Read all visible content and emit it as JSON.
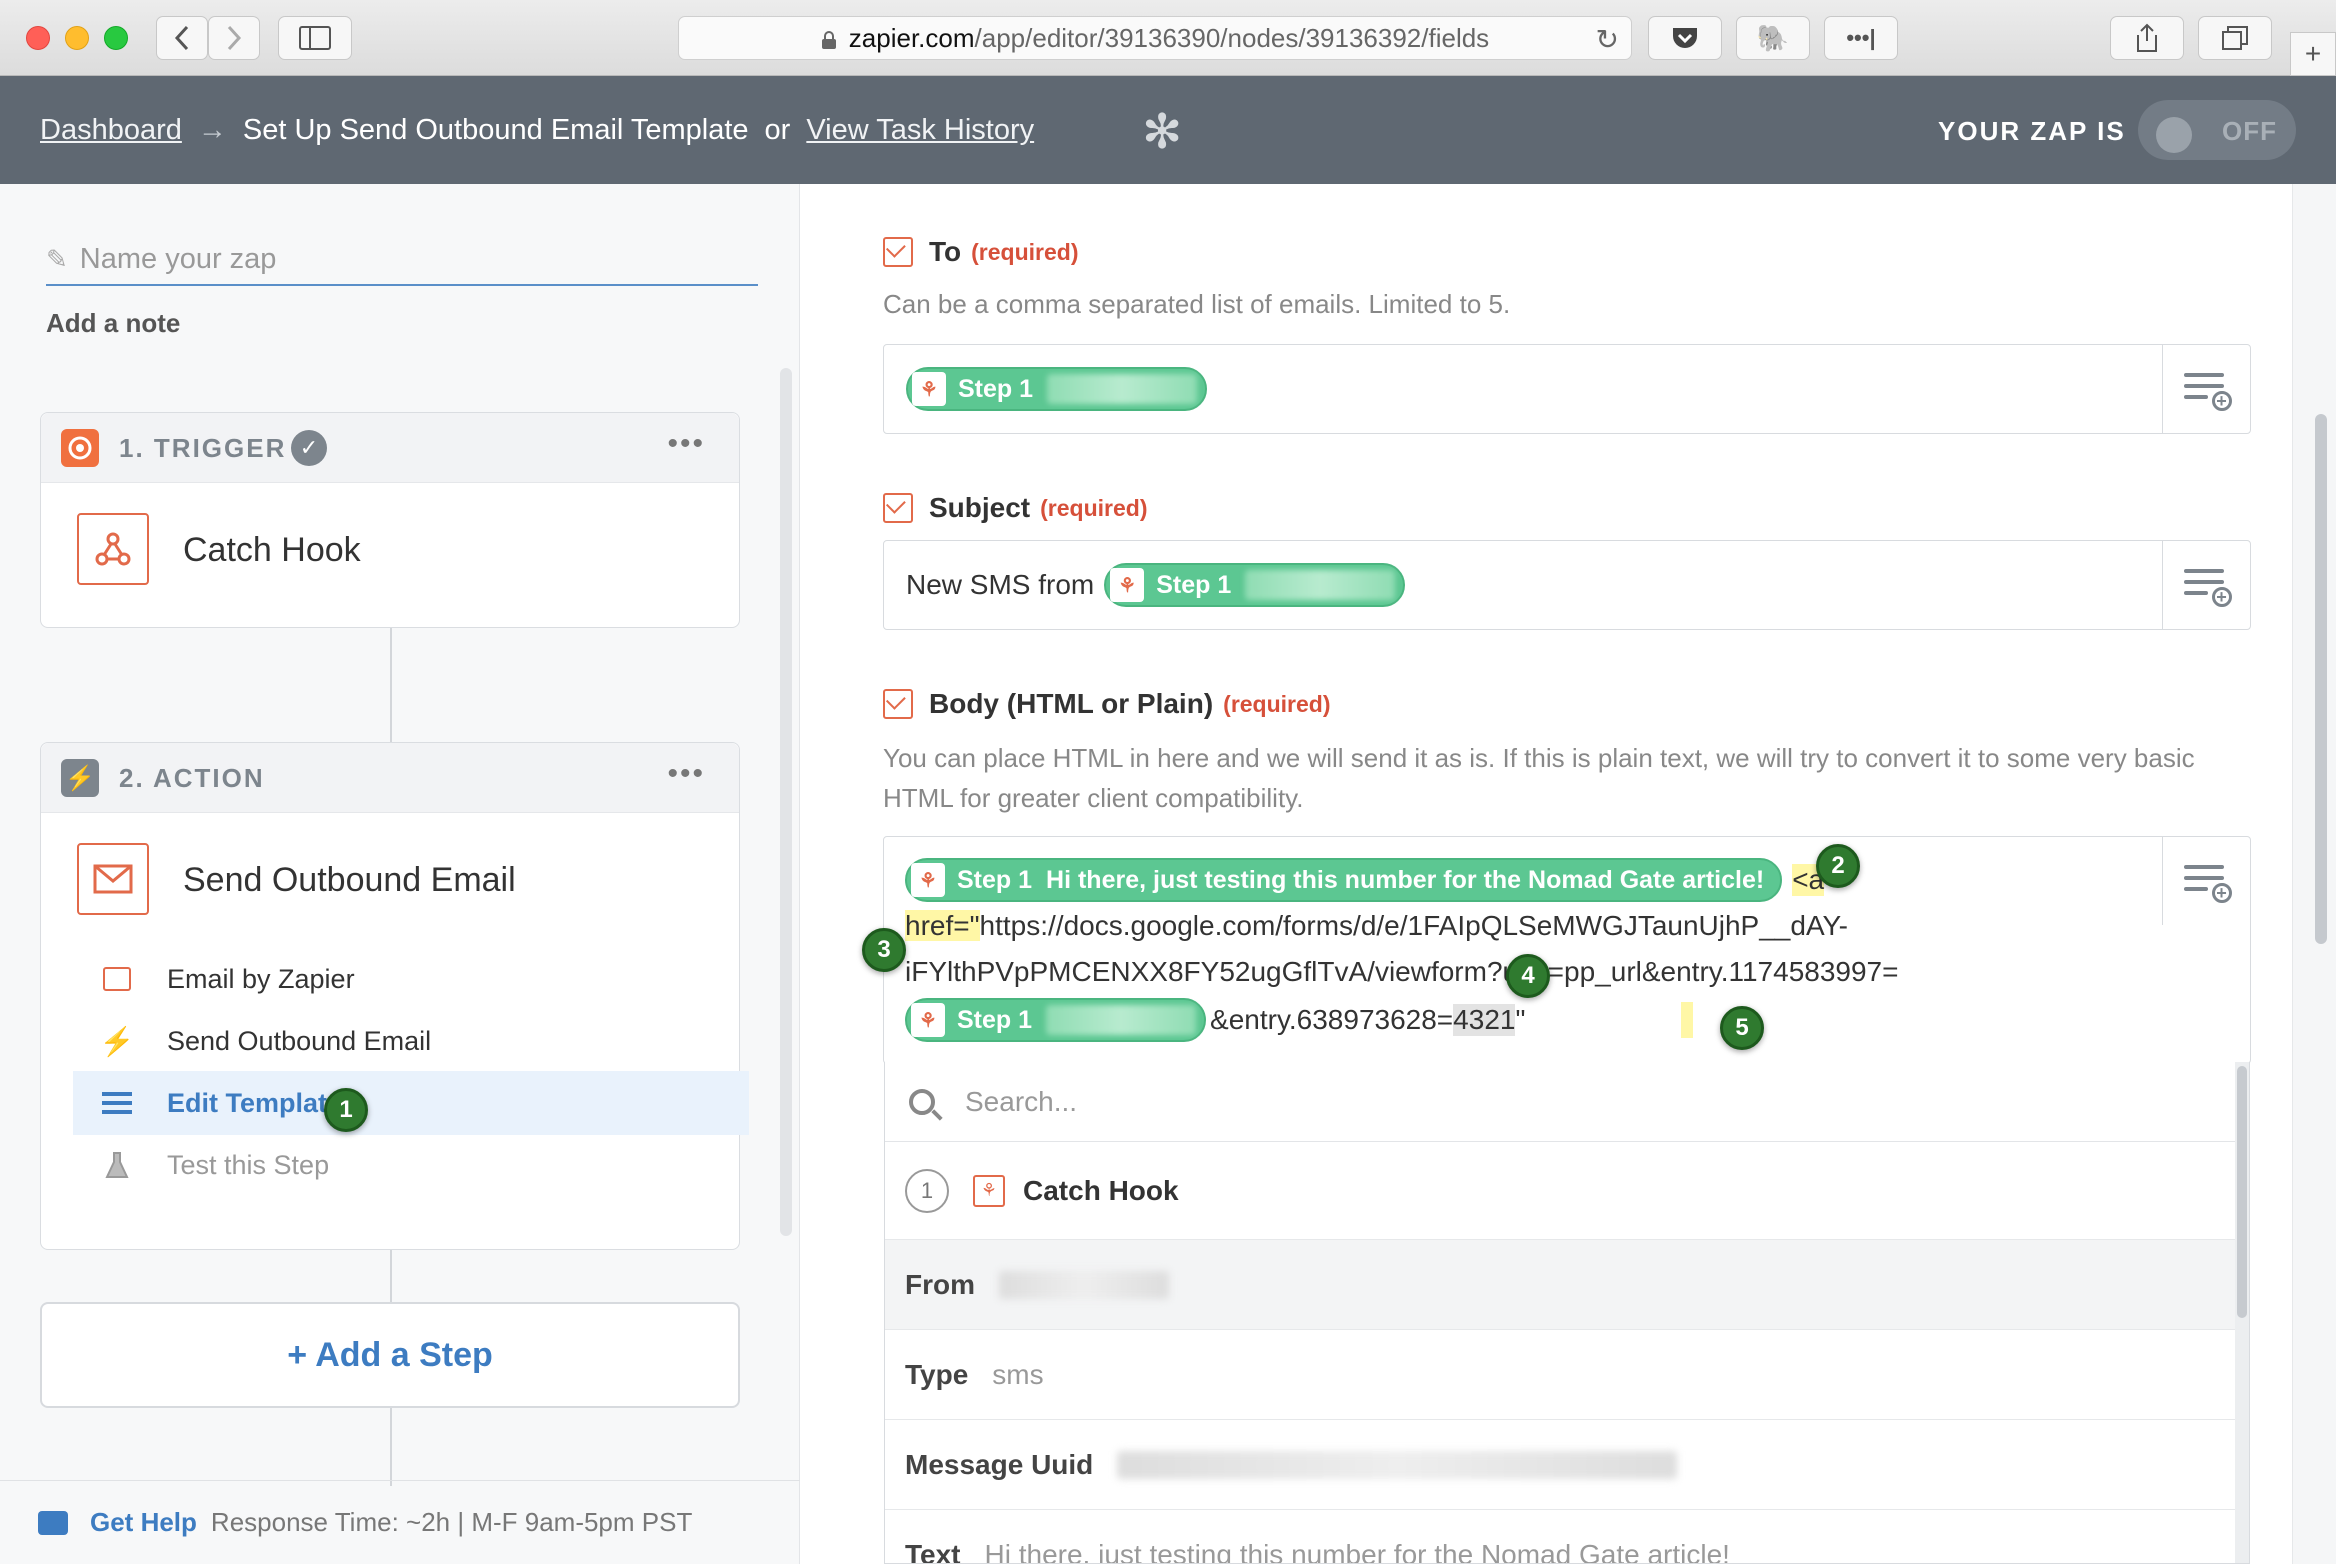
{
  "browser": {
    "url_host": "zapier.com",
    "url_path": "/app/editor/39136390/nodes/39136392/fields",
    "more_label": "•••|"
  },
  "header": {
    "dashboard": "Dashboard",
    "arrow": "→",
    "title": "Set Up Send Outbound Email Template",
    "or": "or",
    "task_history": "View Task History",
    "your_zap_is": "YOUR ZAP IS",
    "toggle_state": "OFF"
  },
  "sidebar": {
    "name_placeholder": "Name your zap",
    "add_note": "Add a note",
    "trigger": {
      "title": "1. TRIGGER",
      "app": "Catch Hook"
    },
    "action": {
      "title": "2. ACTION",
      "app": "Send Outbound Email",
      "items": [
        {
          "label": "Email by Zapier"
        },
        {
          "label": "Send Outbound Email"
        },
        {
          "label": "Edit Template"
        },
        {
          "label": "Test this Step"
        }
      ]
    },
    "add_step": "+ Add a Step",
    "help": {
      "link": "Get Help",
      "text": "Response Time: ~2h | M-F 9am-5pm PST"
    }
  },
  "fields": {
    "to": {
      "label": "To",
      "required": "(required)",
      "help": "Can be a comma separated list of emails. Limited to 5.",
      "pill": "Step 1"
    },
    "subject": {
      "label": "Subject",
      "required": "(required)",
      "prefix": "New SMS from",
      "pill": "Step 1"
    },
    "body": {
      "label": "Body (HTML or Plain)",
      "required": "(required)",
      "help_line1": "You can place HTML in here and we will send it as is. If this is plain text, we will try to convert it to some very basic",
      "help_line2": "HTML for greater client compatibility.",
      "pill1_step": "Step 1",
      "pill1_text": "Hi there, just testing this number for the Nomad Gate article!",
      "tag_open": "<a",
      "line2_href": "href=\"",
      "line2_rest": "https://docs.google.com/forms/d/e/1FAIpQLSeMWGJTaunUjhP__dAY-",
      "line3": "iFYlthPVpPMCENXX8FY52ugGflTvA/viewform?usp=pp_url&entry.1174583997=",
      "pill2_step": "Step 1",
      "line4_a": "&entry.638973628=",
      "line4_b": "4321",
      "line4_c": "\""
    }
  },
  "dropdown": {
    "search_placeholder": "Search...",
    "step_number": "1",
    "step_name": "Catch Hook",
    "rows": [
      {
        "key": "From",
        "value": ""
      },
      {
        "key": "Type",
        "value": "sms"
      },
      {
        "key": "Message Uuid",
        "value": ""
      },
      {
        "key": "Text",
        "value": "Hi there, just testing this number for the Nomad Gate article!"
      }
    ]
  },
  "markers": [
    "1",
    "2",
    "3",
    "4",
    "5"
  ]
}
